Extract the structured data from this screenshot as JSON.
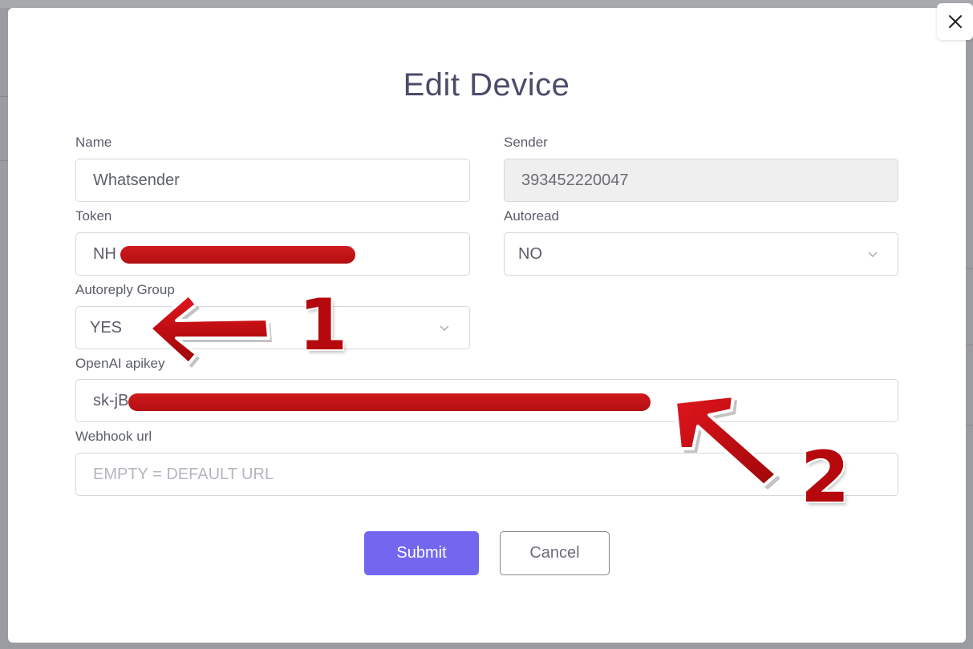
{
  "modal": {
    "title": "Edit Device",
    "close_icon": "close-icon"
  },
  "fields": {
    "name": {
      "label": "Name",
      "value": "Whatsender"
    },
    "sender": {
      "label": "Sender",
      "value": "393452220047"
    },
    "token": {
      "label": "Token",
      "value_visible_prefix": "NH"
    },
    "autoread": {
      "label": "Autoread",
      "value": "NO"
    },
    "autoreply_group": {
      "label": "Autoreply Group",
      "value": "YES"
    },
    "openai_apikey": {
      "label": "OpenAI apikey",
      "value_visible_prefix": "sk-jB"
    },
    "webhook_url": {
      "label": "Webhook url",
      "value": "",
      "placeholder": "EMPTY = DEFAULT URL"
    }
  },
  "buttons": {
    "submit": "Submit",
    "cancel": "Cancel"
  },
  "annotations": {
    "arrow_1": "1",
    "arrow_2": "2",
    "color": "#c0080d"
  },
  "colors": {
    "primary": "#7367f0",
    "title": "#4b4c6a",
    "overlay": "#8d8f94"
  }
}
